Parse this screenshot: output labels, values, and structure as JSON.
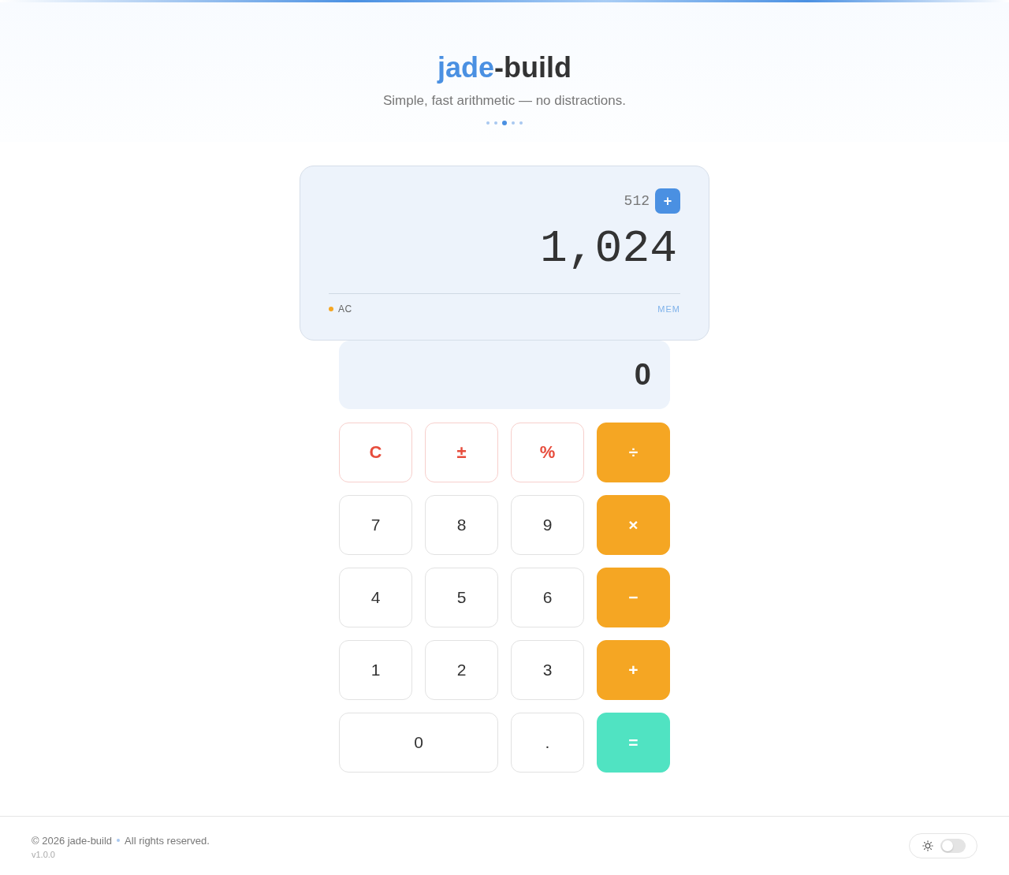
{
  "header": {
    "title": {
      "accent": "jade",
      "rest": "-build"
    },
    "subtitle": "Simple, fast arithmetic — no distractions.",
    "page_dots": [
      {
        "selected": false
      },
      {
        "selected": false
      },
      {
        "selected": true
      },
      {
        "selected": false
      },
      {
        "selected": false
      }
    ]
  },
  "display": {
    "operand": "512",
    "operator": "+",
    "result": "1,024",
    "status": "AC",
    "memory": "MEM"
  },
  "input": {
    "value": "0"
  },
  "keys": [
    {
      "label": "C",
      "kind": "function",
      "wide": false
    },
    {
      "label": "±",
      "kind": "function",
      "wide": false
    },
    {
      "label": "%",
      "kind": "function",
      "wide": false
    },
    {
      "label": "÷",
      "kind": "operator",
      "wide": false
    },
    {
      "label": "7",
      "kind": "digit",
      "wide": false
    },
    {
      "label": "8",
      "kind": "digit",
      "wide": false
    },
    {
      "label": "9",
      "kind": "digit",
      "wide": false
    },
    {
      "label": "×",
      "kind": "operator",
      "wide": false
    },
    {
      "label": "4",
      "kind": "digit",
      "wide": false
    },
    {
      "label": "5",
      "kind": "digit",
      "wide": false
    },
    {
      "label": "6",
      "kind": "digit",
      "wide": false
    },
    {
      "label": "−",
      "kind": "operator",
      "wide": false
    },
    {
      "label": "1",
      "kind": "digit",
      "wide": false
    },
    {
      "label": "2",
      "kind": "digit",
      "wide": false
    },
    {
      "label": "3",
      "kind": "digit",
      "wide": false
    },
    {
      "label": "+",
      "kind": "operator",
      "wide": false
    },
    {
      "label": "0",
      "kind": "digit",
      "wide": true
    },
    {
      "label": ".",
      "kind": "digit",
      "wide": false
    },
    {
      "label": "=",
      "kind": "equals",
      "wide": false
    }
  ],
  "footer": {
    "copyright": "© 2026 jade-build",
    "rights": "All rights reserved.",
    "version": "v1.0.0",
    "theme_toggle": {
      "on": false
    }
  }
}
